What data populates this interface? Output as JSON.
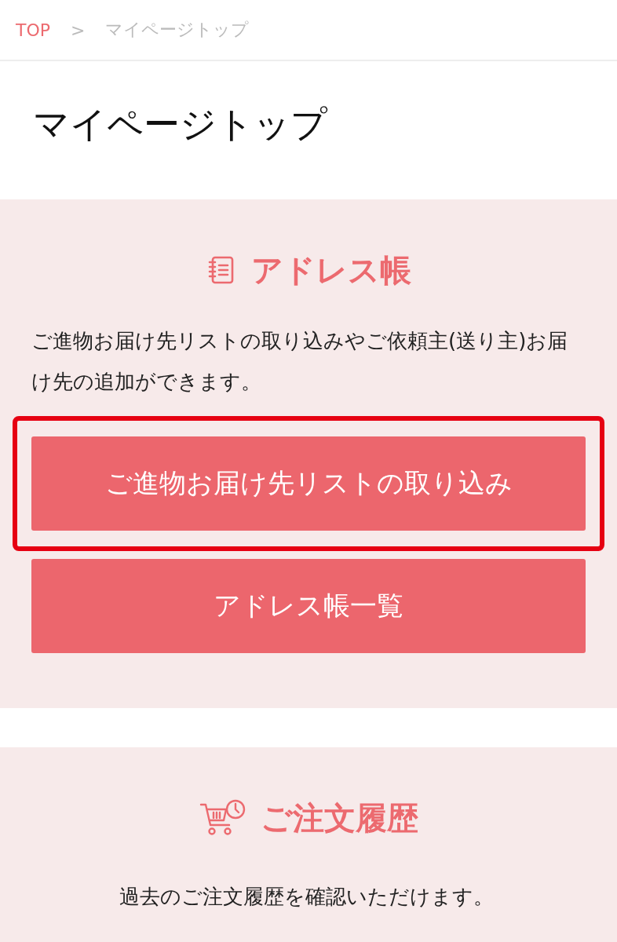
{
  "breadcrumb": [
    {
      "label": "TOP",
      "link": true
    },
    {
      "label": ">",
      "link": false
    },
    {
      "label": "マイページトップ",
      "link": false
    }
  ],
  "page_title": "マイページトップ",
  "sections": [
    {
      "kind": "address-book",
      "title": "アドレス帳",
      "description": "ご進物お届け先リストの取り込みやご依頼主(送り主)お届け先の追加ができます。",
      "buttons": [
        {
          "label": "ご進物お届け先リストの取り込み",
          "highlighted": true
        },
        {
          "label": "アドレス帳一覧",
          "highlighted": false
        }
      ]
    },
    {
      "kind": "cart-clock",
      "title": "ご注文履歴",
      "description": "過去のご注文履歴を確認いただけます。"
    }
  ]
}
